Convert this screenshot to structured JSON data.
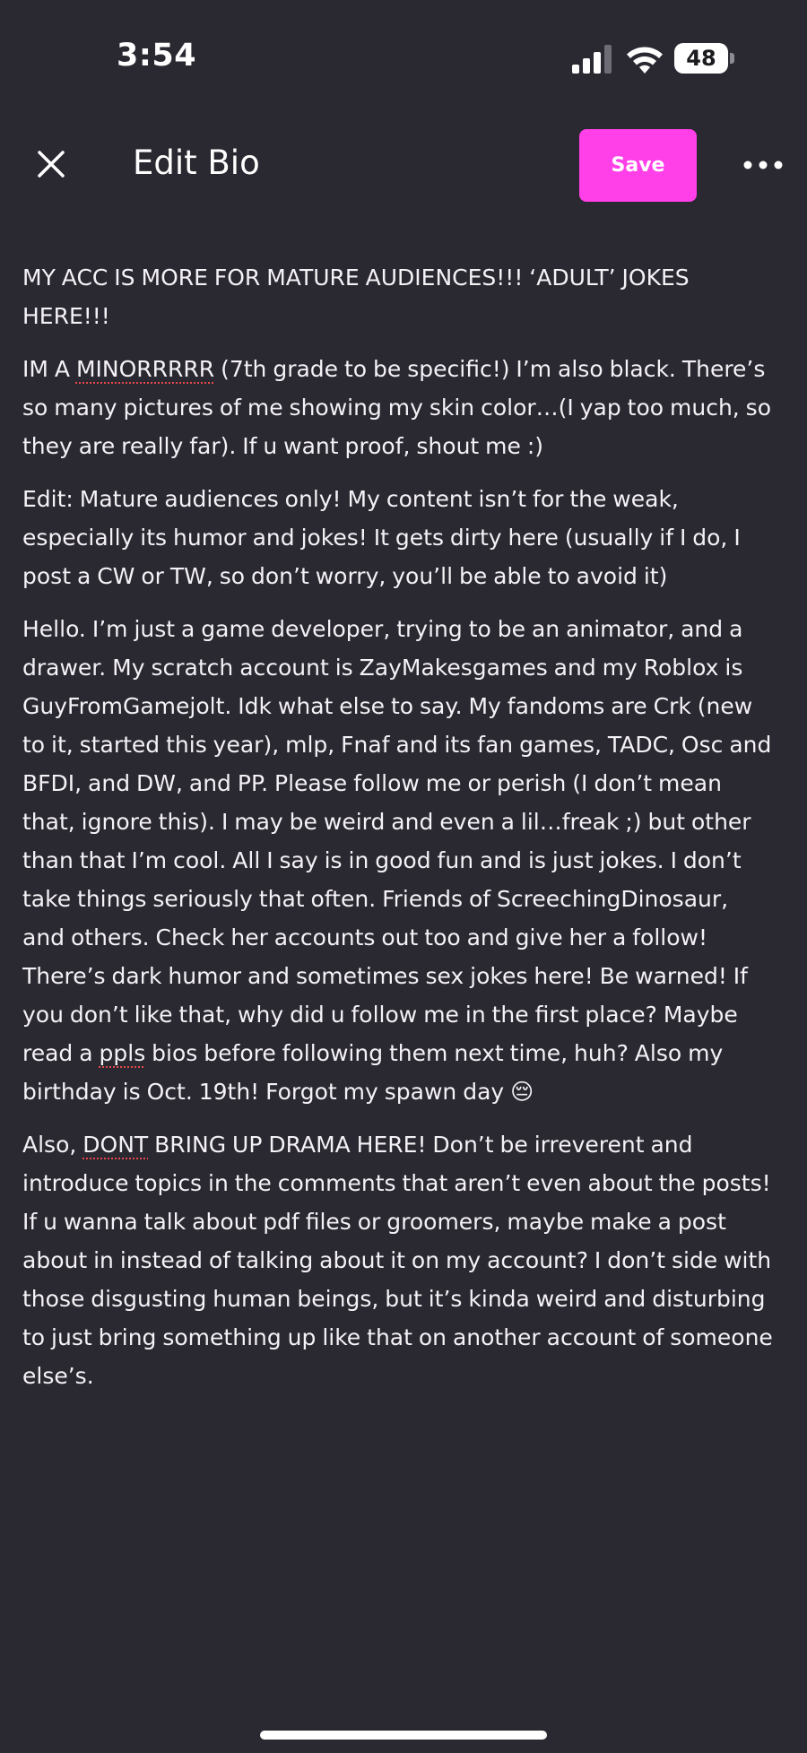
{
  "status_bar": {
    "time": "3:54",
    "battery": "48",
    "signal_icon": "cellular-signal-icon",
    "wifi_icon": "wifi-icon"
  },
  "header": {
    "close_icon": "close-icon",
    "title": "Edit Bio",
    "save_label": "Save",
    "more_icon": "more-horizontal-icon"
  },
  "colors": {
    "background": "#2a2830",
    "accent": "#ff40e8",
    "text": "#ffffff",
    "spellcheck": "#e8484a"
  },
  "bio": {
    "p1": "MY ACC IS MORE FOR MATURE AUDIENCES!!! ‘ADULT’ JOKES HERE!!!",
    "p2_word1": "IM A ",
    "p2_misspelled": "MINORRRRR",
    "p2_rest": " (7th grade to be specific!) I’m also black. There’s so many pictures of me showing my skin color…(I yap too much, so they are really far). If u want proof, shout me :)",
    "p3": "Edit: Mature audiences only! My content isn’t for the weak, especially its humor and jokes! It gets dirty here (usually if I do, I post a CW or TW, so don’t worry, you’ll be able to avoid it)",
    "p4_part1": "Hello. I’m just a game developer, trying to be an animator, and a drawer. My scratch account is ZayMakesgames and my Roblox is GuyFromGamejolt. Idk what else to say. My fandoms are Crk (new to it, started this year), mlp, Fnaf and its fan games, TADC, Osc and BFDI, and DW, and PP. Please follow me or perish (I don’t mean that, ignore this). I may be weird and even a lil…freak ;) but other than that I’m cool. All I say is in good fun and is just jokes. I don’t take things seriously that often. Friends of ScreechingDinosaur, and others. Check her accounts out too and give her a follow! There’s dark humor and sometimes sex jokes here! Be warned! If you don’t like that, why did u follow me in the first place? Maybe read a ",
    "p4_misspelled": "ppls",
    "p4_part2": " bios before following them next time, huh? Also my birthday is Oct. 19th! Forgot my spawn day 😔",
    "p5_word1": "Also, ",
    "p5_misspelled": "DONT",
    "p5_rest": " BRING UP DRAMA HERE! Don’t be irreverent and introduce topics in the comments that aren’t even about the posts! If u wanna talk about pdf files or groomers, maybe make a post about in instead of talking about it on my account? I don’t side with those disgusting human beings, but it’s kinda weird and disturbing to just bring something up like that on another account of someone else’s."
  }
}
